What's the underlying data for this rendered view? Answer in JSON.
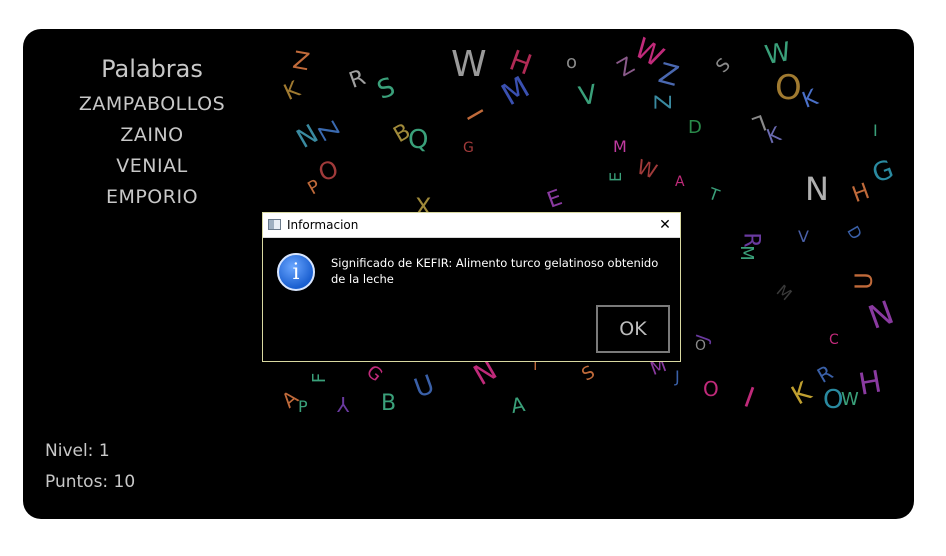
{
  "words_panel": {
    "title": "Palabras",
    "words": [
      "ZAMPABOLLOS",
      "ZAINO",
      "VENIAL",
      "EMPORIO"
    ]
  },
  "stats": {
    "nivel": "Nivel: 1",
    "puntos": "Puntos: 10"
  },
  "falling_letters": [
    {
      "ch": "Z",
      "color": "#c06a3a"
    },
    {
      "ch": "R",
      "color": "#a0a0a0"
    },
    {
      "ch": "W",
      "color": "#9a9a9a"
    },
    {
      "ch": "H",
      "color": "#b02a55"
    },
    {
      "ch": "o",
      "color": "#8a8a8a"
    },
    {
      "ch": "Z",
      "color": "#8a5a8a"
    },
    {
      "ch": "W",
      "color": "#c02a7a"
    },
    {
      "ch": "Z",
      "color": "#4a68b0"
    },
    {
      "ch": "S",
      "color": "#8a8a8a"
    },
    {
      "ch": "W",
      "color": "#3aa07a"
    },
    {
      "ch": "O",
      "color": "#a07a30"
    },
    {
      "ch": "K",
      "color": "#4a70c8"
    },
    {
      "ch": "K",
      "color": "#a07a30"
    },
    {
      "ch": "S",
      "color": "#3aa07a"
    },
    {
      "ch": "M",
      "color": "#3a50b0"
    },
    {
      "ch": "V",
      "color": "#3aa07a"
    },
    {
      "ch": "I",
      "color": "#c06a3a"
    },
    {
      "ch": "Z",
      "color": "#3a8aa0"
    },
    {
      "ch": "B",
      "color": "#a08a3a"
    },
    {
      "ch": "Q",
      "color": "#3aa07a"
    },
    {
      "ch": "G",
      "color": "#a03a3a"
    },
    {
      "ch": "D",
      "color": "#2a8a4a"
    },
    {
      "ch": "L",
      "color": "#8a8a8a"
    },
    {
      "ch": "I",
      "color": "#3aa07a"
    },
    {
      "ch": "G",
      "color": "#2a8aa0"
    },
    {
      "ch": "N",
      "color": "#3a8aa0"
    },
    {
      "ch": "Z",
      "color": "#3a6ab0"
    },
    {
      "ch": "K",
      "color": "#6a6ab0"
    },
    {
      "ch": "M",
      "color": "#c03aa0"
    },
    {
      "ch": "E",
      "color": "#3aa07a"
    },
    {
      "ch": "W",
      "color": "#a03a3a"
    },
    {
      "ch": "A",
      "color": "#c02a7a"
    },
    {
      "ch": "T",
      "color": "#3aa07a"
    },
    {
      "ch": "N",
      "color": "#b0b0b0"
    },
    {
      "ch": "H",
      "color": "#c06a3a"
    },
    {
      "ch": "O",
      "color": "#a03a3a"
    },
    {
      "ch": "P",
      "color": "#c06a3a"
    },
    {
      "ch": "X",
      "color": "#a08a3a"
    },
    {
      "ch": "E",
      "color": "#8a3aa0"
    },
    {
      "ch": "R",
      "color": "#6a3aa0"
    },
    {
      "ch": "M",
      "color": "#3aa07a"
    },
    {
      "ch": "V",
      "color": "#4a60a8"
    },
    {
      "ch": "D",
      "color": "#3a60a8"
    },
    {
      "ch": "U",
      "color": "#c06a3a"
    },
    {
      "ch": "N",
      "color": "#8a3aa0"
    },
    {
      "ch": "M",
      "color": "#3a3a3a"
    },
    {
      "ch": "C",
      "color": "#c02a7a"
    },
    {
      "ch": "J",
      "color": "#6a3aa0"
    },
    {
      "ch": "A",
      "color": "#c06a3a"
    },
    {
      "ch": "P",
      "color": "#3aa07a"
    },
    {
      "ch": "Y",
      "color": "#6a3aa0"
    },
    {
      "ch": "B",
      "color": "#3aa07a"
    },
    {
      "ch": "U",
      "color": "#3a60a8"
    },
    {
      "ch": "N",
      "color": "#c02a7a"
    },
    {
      "ch": "A",
      "color": "#3aa07a"
    },
    {
      "ch": "S",
      "color": "#c06a3a"
    },
    {
      "ch": "M",
      "color": "#8a3aa0"
    },
    {
      "ch": "J",
      "color": "#3a60a8"
    },
    {
      "ch": "O",
      "color": "#c02a7a"
    },
    {
      "ch": "I",
      "color": "#c02a7a"
    },
    {
      "ch": "K",
      "color": "#c0a030"
    },
    {
      "ch": "R",
      "color": "#3a60a8"
    },
    {
      "ch": "O",
      "color": "#2a8aa0"
    },
    {
      "ch": "W",
      "color": "#3aa07a"
    },
    {
      "ch": "H",
      "color": "#8a3aa0"
    },
    {
      "ch": "O",
      "color": "#8a8a8a"
    },
    {
      "ch": "T",
      "color": "#c06a3a"
    },
    {
      "ch": "G",
      "color": "#c02a7a"
    },
    {
      "ch": "F",
      "color": "#3aa07a"
    }
  ],
  "dialog": {
    "title": "Informacion",
    "message": "Significado de KEFIR: Alimento turco gelatinoso obtenido de la leche",
    "ok_label": "OK",
    "info_glyph": "i",
    "close_glyph": "✕"
  }
}
